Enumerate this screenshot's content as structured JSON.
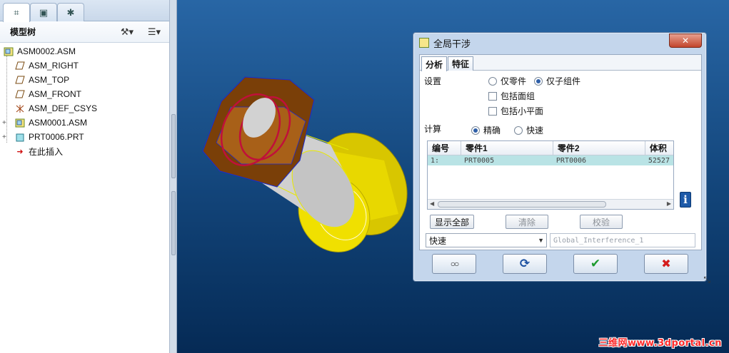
{
  "left_panel": {
    "tree_title": "模型树",
    "tree_items": [
      {
        "label": "ASM0002.ASM",
        "icon": "assembly-icon"
      },
      {
        "label": "ASM_RIGHT",
        "icon": "datum-plane-icon"
      },
      {
        "label": "ASM_TOP",
        "icon": "datum-plane-icon"
      },
      {
        "label": "ASM_FRONT",
        "icon": "datum-plane-icon"
      },
      {
        "label": "ASM_DEF_CSYS",
        "icon": "csys-icon"
      },
      {
        "label": "ASM0001.ASM",
        "icon": "assembly-icon"
      },
      {
        "label": "PRT0006.PRT",
        "icon": "part-icon"
      },
      {
        "label": "在此插入",
        "icon": "insert-arrow-icon"
      }
    ]
  },
  "dialog": {
    "title": "全局干涉",
    "tabs": [
      "分析",
      "特征"
    ],
    "setting_label": "设置",
    "option_parts_only": "仅零件",
    "option_subassemblies_only": "仅子组件",
    "checkbox_include_quilts": "包括面组",
    "checkbox_include_facets": "包括小平面",
    "compute_label": "计算",
    "option_exact": "精确",
    "option_quick": "快速",
    "table": {
      "headers": [
        "编号",
        "零件1",
        "零件2",
        "体积"
      ],
      "rows": [
        [
          "1:",
          "PRT0005",
          "PRT0006",
          "52527"
        ]
      ]
    },
    "btn_show_all": "显示全部",
    "btn_clear": "清除",
    "btn_verify": "校验",
    "combo_value": "快速",
    "name_field_value": "Global_Interference_1",
    "bottom_buttons": [
      {
        "name": "glasses-icon",
        "symbol": "○○"
      },
      {
        "name": "refresh-icon",
        "symbol": "⟳"
      },
      {
        "name": "ok-check-icon",
        "symbol": "✔"
      },
      {
        "name": "cancel-x-icon",
        "symbol": "✖"
      }
    ]
  },
  "watermark": "三维网www.3dportal.cn",
  "colors": {
    "viewport_top": "#2866a5",
    "viewport_bottom": "#052a55",
    "part_yellow": "#f0e000",
    "part_brown": "#8a4a10",
    "ok_green": "#1c9a2e",
    "cancel_red": "#d41c1c"
  }
}
